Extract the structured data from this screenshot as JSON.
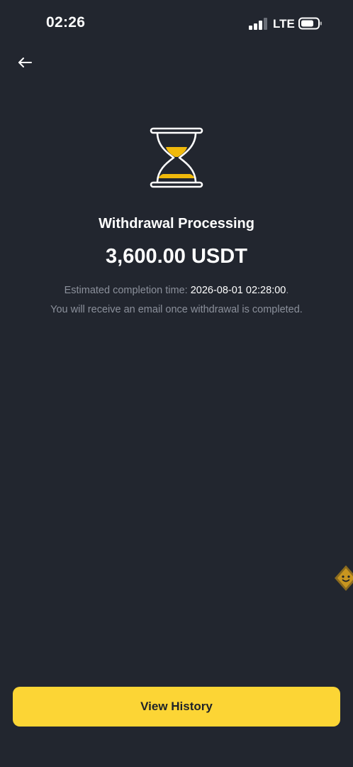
{
  "status_bar": {
    "time": "02:26",
    "network": "LTE",
    "signal_icon": "cellular-signal-icon",
    "battery_icon": "battery-icon"
  },
  "nav": {
    "back_icon": "arrow-left-icon"
  },
  "status": {
    "icon": "hourglass-icon",
    "title": "Withdrawal Processing",
    "amount": "3,600.00 USDT",
    "estimate_label": "Estimated completion time: ",
    "estimate_value": "2026-08-01 02:28:00",
    "estimate_suffix": ".",
    "email_note": "You will receive an email once withdrawal is completed."
  },
  "assistant": {
    "icon": "smiley-assistant-icon"
  },
  "actions": {
    "view_history_label": "View History"
  },
  "colors": {
    "background": "#22262f",
    "accent": "#fcd535",
    "secondary_text": "#8b909b"
  }
}
